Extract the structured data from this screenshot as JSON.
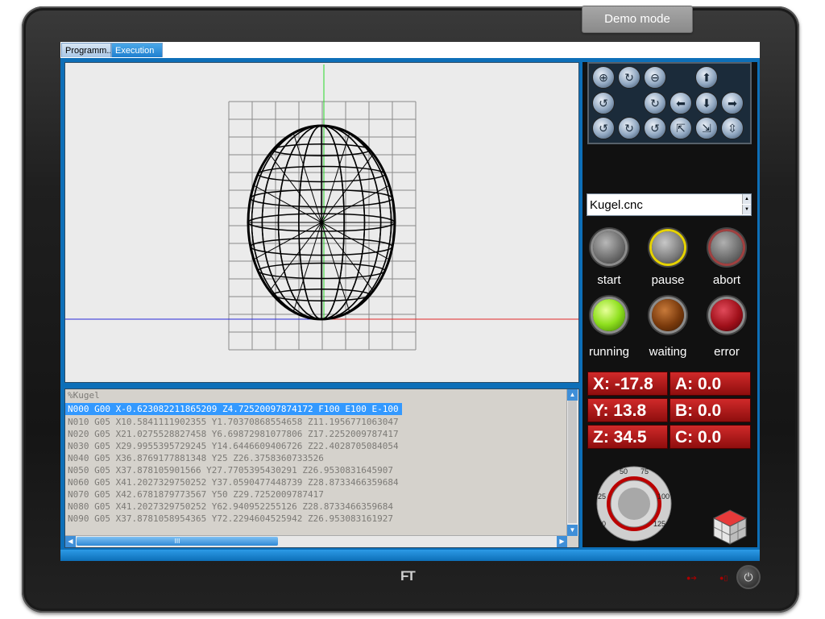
{
  "tabs": [
    {
      "label": "Programm..."
    },
    {
      "label": "Execution"
    }
  ],
  "demo_mode_label": "Demo mode",
  "file": {
    "name": "Kugel.cnc"
  },
  "buttons": {
    "start": "start",
    "pause": "pause",
    "abort": "abort"
  },
  "status": {
    "running": "running",
    "waiting": "waiting",
    "error": "error"
  },
  "coords": {
    "x": "X: -17.8",
    "y": "Y: 13.8",
    "z": "Z: 34.5",
    "a": "A: 0.0",
    "b": "B: 0.0",
    "c": "C: 0.0"
  },
  "dial": {
    "ticks": [
      "50",
      "75",
      "25",
      "100",
      "0",
      "125"
    ]
  },
  "code": {
    "lines": [
      "%Kugel",
      "N000 G00 X-0.623082211865209 Z4.72520097874172 F100 E100 E-100",
      "N010 G05 X10.5841111902355 Y1.70370868554658 Z11.1956771063047",
      "N020 G05 X21.0275528827458 Y6.69872981077806 Z17.2252009787417",
      "N030 G05 X29.9955395729245 Y14.6446609406726 Z22.4028705084054",
      "N040 G05 X36.8769177881348 Y25 Z26.3758360733526",
      "N050 G05 X37.878105901566 Y27.7705395430291 Z26.9530831645907",
      "N060 G05 X41.2027329750252 Y37.0590477448739 Z28.8733466359684",
      "N070 G05 X42.6781879773567 Y50 Z29.7252009787417",
      "N080 G05 X41.2027329750252 Y62.940952255126 Z28.8733466359684",
      "N090 G05 X37.8781058954365 Y72.2294604525942 Z26.953083161927"
    ]
  },
  "hscroll_grip": "III",
  "brand": "FT",
  "colors": {
    "frame_blue": "#0d6fb8",
    "selection": "#3399ff",
    "coord_red": "#c01a1a",
    "lamp_green": "#8fe01e",
    "lamp_brown": "#7a3a0c",
    "lamp_red": "#a0101a"
  }
}
